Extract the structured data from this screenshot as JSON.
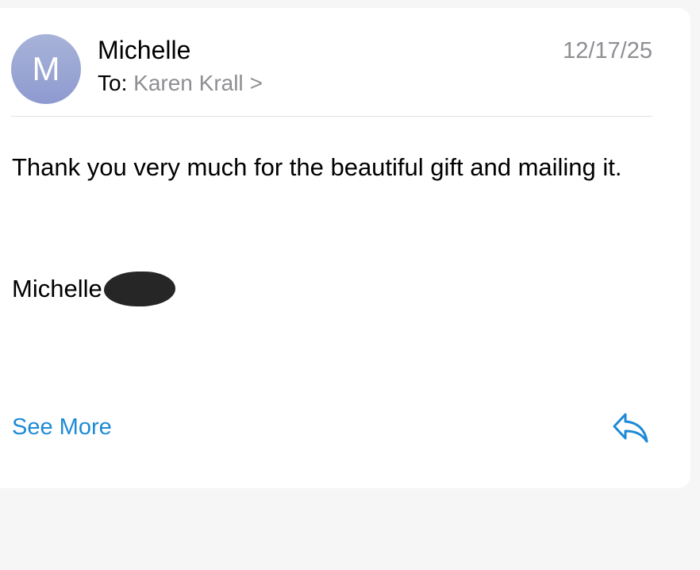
{
  "message": {
    "avatar_initial": "M",
    "sender": "Michelle",
    "to_label": "To:",
    "recipient": "Karen Krall",
    "recipient_chevron": ">",
    "date": "12/17/25",
    "body_line": "Thank you very much for the beautiful gift and mailing it.",
    "signature": "Michelle"
  },
  "actions": {
    "see_more": "See More",
    "reply_icon": "reply-arrow"
  },
  "colors": {
    "accent": "#1e8ad6",
    "secondary_text": "#8e8e93",
    "avatar": "#98a3d4"
  }
}
